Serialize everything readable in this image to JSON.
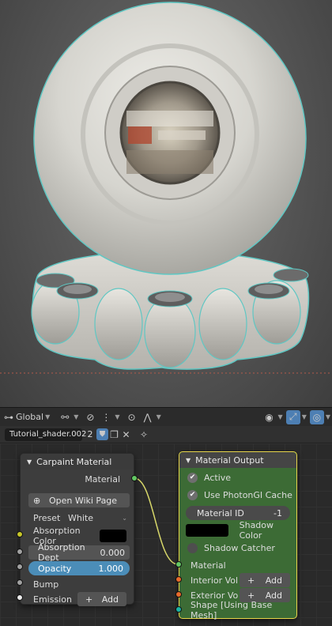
{
  "header": {
    "transform_orientation": "Global"
  },
  "material_slot": {
    "name": "Tutorial_shader.002",
    "users": "2"
  },
  "carpaint_node": {
    "title": "Carpaint Material",
    "output_label": "Material",
    "wiki_button": "Open Wiki Page",
    "preset_label": "Preset",
    "preset_value": "White",
    "absorption_color_label": "Absorption Color",
    "absorption_color": "#000000",
    "absorption_depth_label": "Absorption Dept",
    "absorption_depth_value": "0.000",
    "opacity_label": "Opacity",
    "opacity_value": "1.000",
    "opacity_fraction": 1.0,
    "bump_label": "Bump",
    "emission_label": "Emission",
    "add_label": "Add"
  },
  "output_node": {
    "title": "Material Output",
    "active_label": "Active",
    "photongi_label": "Use PhotonGI Cache",
    "material_id_label": "Material ID",
    "material_id_value": "-1",
    "shadow_color_label": "Shadow Color",
    "shadow_color": "#000000",
    "shadow_catcher_label": "Shadow Catcher",
    "material_label": "Material",
    "interior_label": "Interior Volu...",
    "exterior_label": "Exterior Vol...",
    "add_label": "Add",
    "shape_label": "Shape [Using Base Mesh]"
  },
  "colors": {
    "node_header_carpaint": "#3b3b3b",
    "node_body_carpaint": "#3d3d3d",
    "node_header_output": "#454545",
    "node_body_output": "#3c6b35",
    "selection": "#e6d44a",
    "socket_shader": "#63c763",
    "socket_yellow": "#c7c729",
    "socket_gray": "#a1a1a1",
    "socket_volume": "#e86a2b",
    "socket_shape": "#19b3a6",
    "slider_blue": "#4b8db8"
  }
}
